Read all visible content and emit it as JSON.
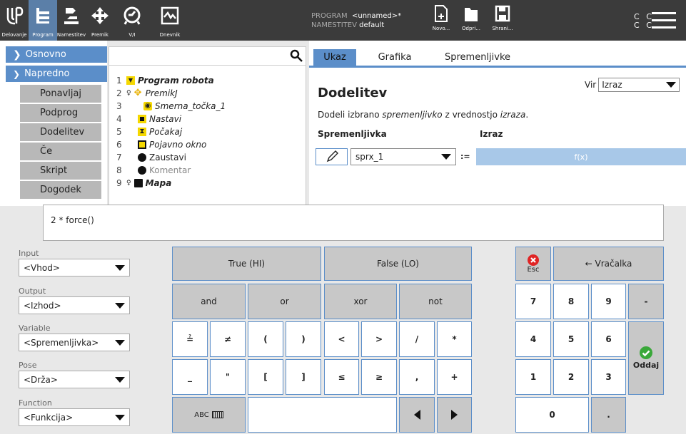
{
  "topbar": {
    "tabs": [
      {
        "label": "Delovanje",
        "icon": "ur-logo-icon"
      },
      {
        "label": "Program",
        "icon": "program-icon"
      },
      {
        "label": "Namestitev",
        "icon": "robot-arm-icon"
      },
      {
        "label": "Premik",
        "icon": "move-arrows-icon"
      },
      {
        "label": "V/I",
        "icon": "io-icon"
      },
      {
        "label": "Dnevnik",
        "icon": "log-icon"
      }
    ],
    "program_label": "PROGRAM",
    "program_value": "<unnamed>*",
    "installation_label": "NAMESTITEV",
    "installation_value": "default",
    "file_buttons": [
      {
        "label": "Novo...",
        "icon": "new-file-icon"
      },
      {
        "label": "Odpri...",
        "icon": "open-folder-icon"
      },
      {
        "label": "Shrani...",
        "icon": "save-icon"
      }
    ],
    "status_letters": [
      "C",
      "C",
      "C",
      "C"
    ]
  },
  "leftnav": {
    "headers": [
      "Osnovno",
      "Napredno"
    ],
    "items": [
      "Ponavljaj",
      "Podprog",
      "Dodelitev",
      "Če",
      "Skript",
      "Dogodek"
    ]
  },
  "tree": {
    "search_value": "",
    "lines": [
      {
        "n": "1",
        "label": "Program robota"
      },
      {
        "n": "2",
        "label": "PremikJ"
      },
      {
        "n": "3",
        "label": "Smerna_točka_1"
      },
      {
        "n": "4",
        "label": "Nastavi"
      },
      {
        "n": "5",
        "label": "Počakaj"
      },
      {
        "n": "6",
        "label": "Pojavno okno"
      },
      {
        "n": "7",
        "label": "Zaustavi"
      },
      {
        "n": "8",
        "label": "Komentar"
      },
      {
        "n": "9",
        "label": "Mapa"
      }
    ]
  },
  "panel": {
    "tabs": [
      "Ukaz",
      "Grafika",
      "Spremenljivke"
    ],
    "title": "Dodelitev",
    "source_label": "Vir",
    "source_value": "Izraz",
    "desc_a": "Dodeli izbrano ",
    "desc_b": "spremenljivko",
    "desc_c": " z vrednostjo ",
    "desc_d": "izraza",
    "desc_e": ".",
    "var_header": "Spremenljivka",
    "expr_header": "Izraz",
    "var_value": "sprx_1",
    "assign_op": ":=",
    "fx_label": "f(x)"
  },
  "expression": "2 * force()",
  "selectors": [
    {
      "label": "Input",
      "value": "<Vhod>"
    },
    {
      "label": "Output",
      "value": "<Izhod>"
    },
    {
      "label": "Variable",
      "value": "<Spremenljivka>"
    },
    {
      "label": "Pose",
      "value": "<Drža>"
    },
    {
      "label": "Function",
      "value": "<Funkcija>"
    }
  ],
  "keys": {
    "true": "True (HI)",
    "false": "False (LO)",
    "and": "and",
    "or": "or",
    "xor": "xor",
    "not": "not",
    "row3": [
      "≟",
      "≠",
      "(",
      ")",
      "<",
      ">",
      "/",
      "*"
    ],
    "row4": [
      "_",
      "\"",
      "[",
      "]",
      "≤",
      "≥",
      ",",
      "+"
    ],
    "abc": "ABC",
    "esc": "Esc",
    "backspace": "← Vračalka",
    "num": [
      "7",
      "8",
      "9",
      "-",
      "4",
      "5",
      "6",
      "1",
      "2",
      "3",
      "0",
      "."
    ],
    "submit": "Oddaj"
  },
  "colors": {
    "accent": "#5b8ec9",
    "topbar": "#3b3b3b",
    "key": "#c8c8c8",
    "esc": "#e02424",
    "ok": "#3aa83a"
  }
}
